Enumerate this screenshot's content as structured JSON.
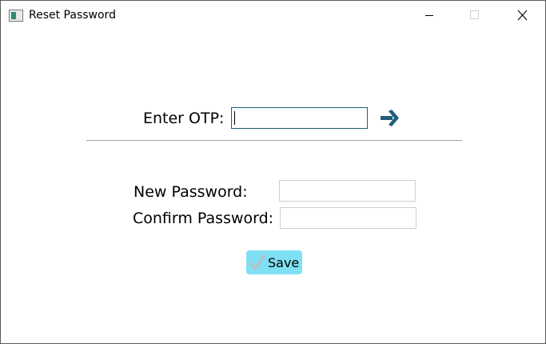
{
  "window": {
    "title": "Reset Password",
    "icon": "app-window-icon",
    "controls": [
      "minimize-icon",
      "maximize-icon",
      "close-icon"
    ]
  },
  "otp": {
    "label": "Enter OTP:",
    "value": "",
    "submit_icon": "arrow-right-icon"
  },
  "new_password": {
    "label": "New Password:",
    "value": ""
  },
  "confirm_password": {
    "label": "Confirm Password:",
    "value": ""
  },
  "save": {
    "label": "Save",
    "icon": "checkmark-icon"
  },
  "colors": {
    "accent_arrow": "#1f5f7a",
    "save_button_bg": "#7fe0f3",
    "otp_focus_border": "#1f5f7a",
    "checkmark": "#b7c2c6"
  }
}
